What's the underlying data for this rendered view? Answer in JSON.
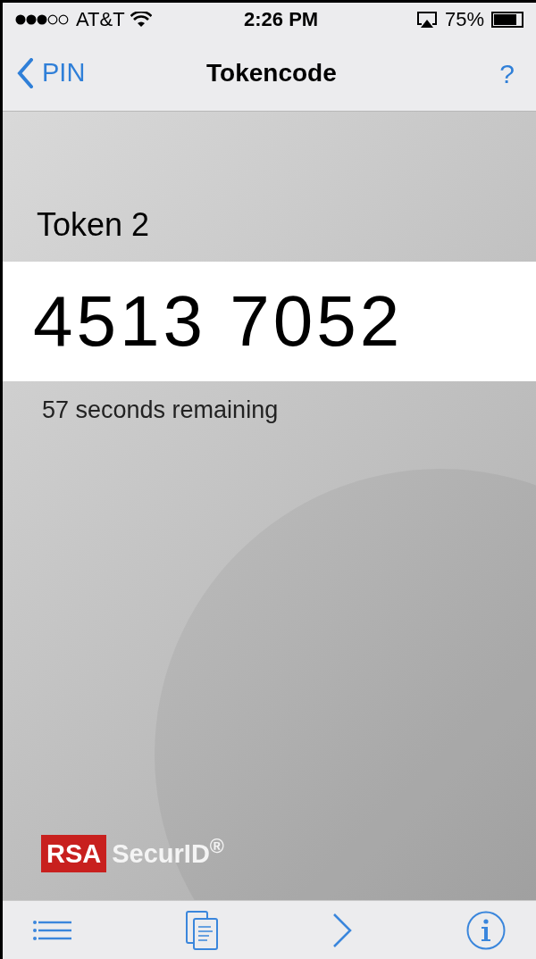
{
  "status_bar": {
    "carrier": "AT&T",
    "time": "2:26 PM",
    "battery": "75%"
  },
  "nav_bar": {
    "back": "PIN",
    "title": "Tokencode",
    "help": "?"
  },
  "token": {
    "name": "Token 2",
    "code": "4513 7052",
    "remaining": "57 seconds remaining"
  },
  "logo": {
    "mark": "RSA",
    "name": "SecurID$^{®}$"
  }
}
